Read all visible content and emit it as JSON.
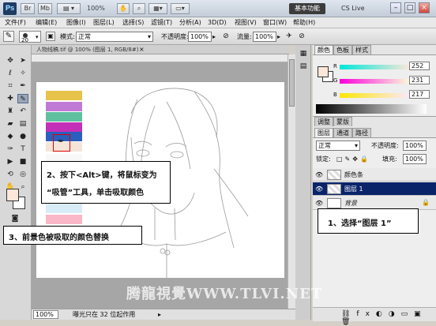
{
  "titlebar": {
    "logo": "Ps",
    "buttons": [
      "Br",
      "Mb"
    ],
    "zoom": "100%",
    "workspace": "基本功能",
    "cs_live": "CS Live",
    "win_min": "–",
    "win_max": "□",
    "win_close": "×"
  },
  "menu": [
    "文件(F)",
    "编辑(E)",
    "图像(I)",
    "图层(L)",
    "选择(S)",
    "滤镜(T)",
    "分析(A)",
    "3D(D)",
    "视图(V)",
    "窗口(W)",
    "帮助(H)"
  ],
  "options": {
    "brush_size": "20",
    "mode_label": "模式:",
    "mode_value": "正常",
    "opacity_label": "不透明度:",
    "opacity_value": "100%",
    "flow_label": "流量:",
    "flow_value": "100%"
  },
  "document": {
    "tab_title": "人物线稿.tif @ 100% (图层 1, RGB/8#)",
    "zoom": "100%",
    "status": "曝光只在 32 位起作用"
  },
  "swatch_colors": [
    "#e8c34a",
    "#c07ad6",
    "#5fc0a0",
    "#c42fb8",
    "#2b5fbd",
    "#f5e4d8",
    "#f8f8f8",
    "#f6c8d6",
    "#d8ecf8",
    "#f9b7c8"
  ],
  "color_panel": {
    "tabs": [
      "颜色",
      "色板",
      "样式"
    ],
    "r_label": "R",
    "r_value": "252",
    "g_label": "G",
    "g_value": "231",
    "b_label": "B",
    "b_value": "217",
    "foreground": "#fce7d9"
  },
  "layers_panel": {
    "tabs": [
      "图层",
      "通道",
      "路径"
    ],
    "upper_tabs": [
      "调整",
      "蒙版"
    ],
    "blend_mode": "正常",
    "opacity_label": "不透明度:",
    "opacity_value": "100%",
    "lock_label": "锁定:",
    "fill_label": "填充:",
    "fill_value": "100%",
    "layers": [
      {
        "name": "颜色条",
        "selected": false
      },
      {
        "name": "图层 1",
        "selected": true
      },
      {
        "name": "背景",
        "selected": false
      }
    ]
  },
  "callouts": {
    "step1": "1、选择“图层 1”",
    "step2_line1": "2、按下<Alt>键，将鼠标变为",
    "step2_line2": "“吸管”工具，单击吸取颜色",
    "step3": "3、前景色被吸取的颜色替换"
  },
  "watermark": "腾龍視覺WWW.TLVI.NET"
}
